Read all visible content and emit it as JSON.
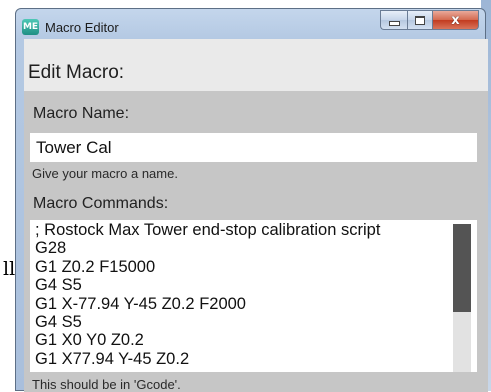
{
  "window": {
    "title": "Macro Editor",
    "app_icon_text": "ME",
    "close_glyph": "x"
  },
  "background": {
    "fragment_text": "ll"
  },
  "dialog": {
    "header": "Edit Macro:",
    "name_label": "Macro Name:",
    "name_value": "Tower Cal",
    "name_hint": "Give your macro a name.",
    "commands_label": "Macro Commands:",
    "commands": [
      "; Rostock Max Tower end-stop calibration script",
      "G28",
      "G1 Z0.2 F15000",
      "G4 S5",
      "G1 X-77.94 Y-45 Z0.2 F2000",
      "G4 S5",
      "G1 X0 Y0 Z0.2",
      "G1 X77.94 Y-45 Z0.2"
    ],
    "commands_hint": "This should be in 'Gcode'.",
    "scroll_position": 0
  },
  "colors": {
    "titlebar": "#b4c9e3",
    "close_button": "#c23b20",
    "panel": "#c6c6c6",
    "client": "#eaeaea"
  }
}
